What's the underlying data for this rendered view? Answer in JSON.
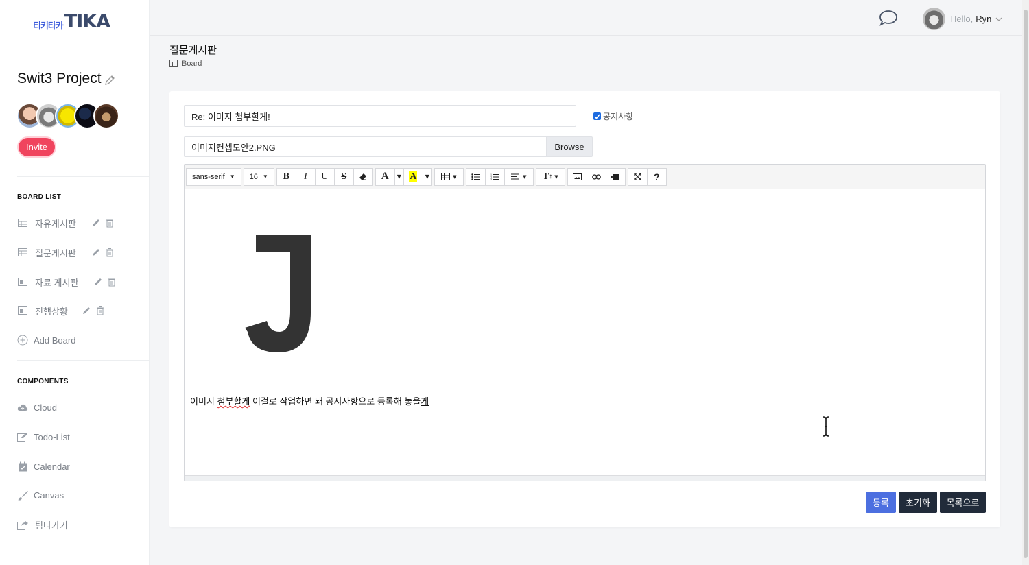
{
  "logo": {
    "korean": "티키타카",
    "english": "TIKA"
  },
  "project": {
    "name": "Swit3 Project",
    "invite_label": "Invite"
  },
  "sidebar": {
    "board_list_title": "BOARD LIST",
    "boards": [
      {
        "label": "자유게시판",
        "icon": "table-icon"
      },
      {
        "label": "질문게시판",
        "icon": "table-icon"
      },
      {
        "label": "자료 게시판",
        "icon": "board-icon"
      },
      {
        "label": "진행상황",
        "icon": "board-icon"
      }
    ],
    "add_board_label": "Add Board",
    "components_title": "COMPONENTS",
    "components": [
      {
        "label": "Cloud",
        "icon": "cloud-icon"
      },
      {
        "label": "Todo-List",
        "icon": "edit-icon"
      },
      {
        "label": "Calendar",
        "icon": "calendar-icon"
      },
      {
        "label": "Canvas",
        "icon": "brush-icon"
      },
      {
        "label": "팀나가기",
        "icon": "exit-icon"
      }
    ]
  },
  "header": {
    "hello": "Hello,",
    "username": "Ryn"
  },
  "page": {
    "title": "질문게시판",
    "breadcrumb": "Board"
  },
  "form": {
    "title_value": "Re: 이미지 첨부할게!",
    "notice_label": "공지사항",
    "notice_checked": true,
    "file_name": "이미지컨셉도안2.PNG",
    "browse_label": "Browse"
  },
  "toolbar": {
    "font_family": "sans-serif",
    "font_size": "16"
  },
  "editor": {
    "image_glyph": "J",
    "text_before": "이미지 ",
    "text_spell1": "첨부할게",
    "text_middle": " 이걸로 작업하면 돼 공지사항으로 등록해 놓을",
    "text_spell2": "게"
  },
  "buttons": {
    "submit": "등록",
    "reset": "초기화",
    "list": "목록으로"
  },
  "colors": {
    "accent": "#4c6fe0",
    "invite": "#f0445e",
    "dark_button": "#212b3a"
  }
}
